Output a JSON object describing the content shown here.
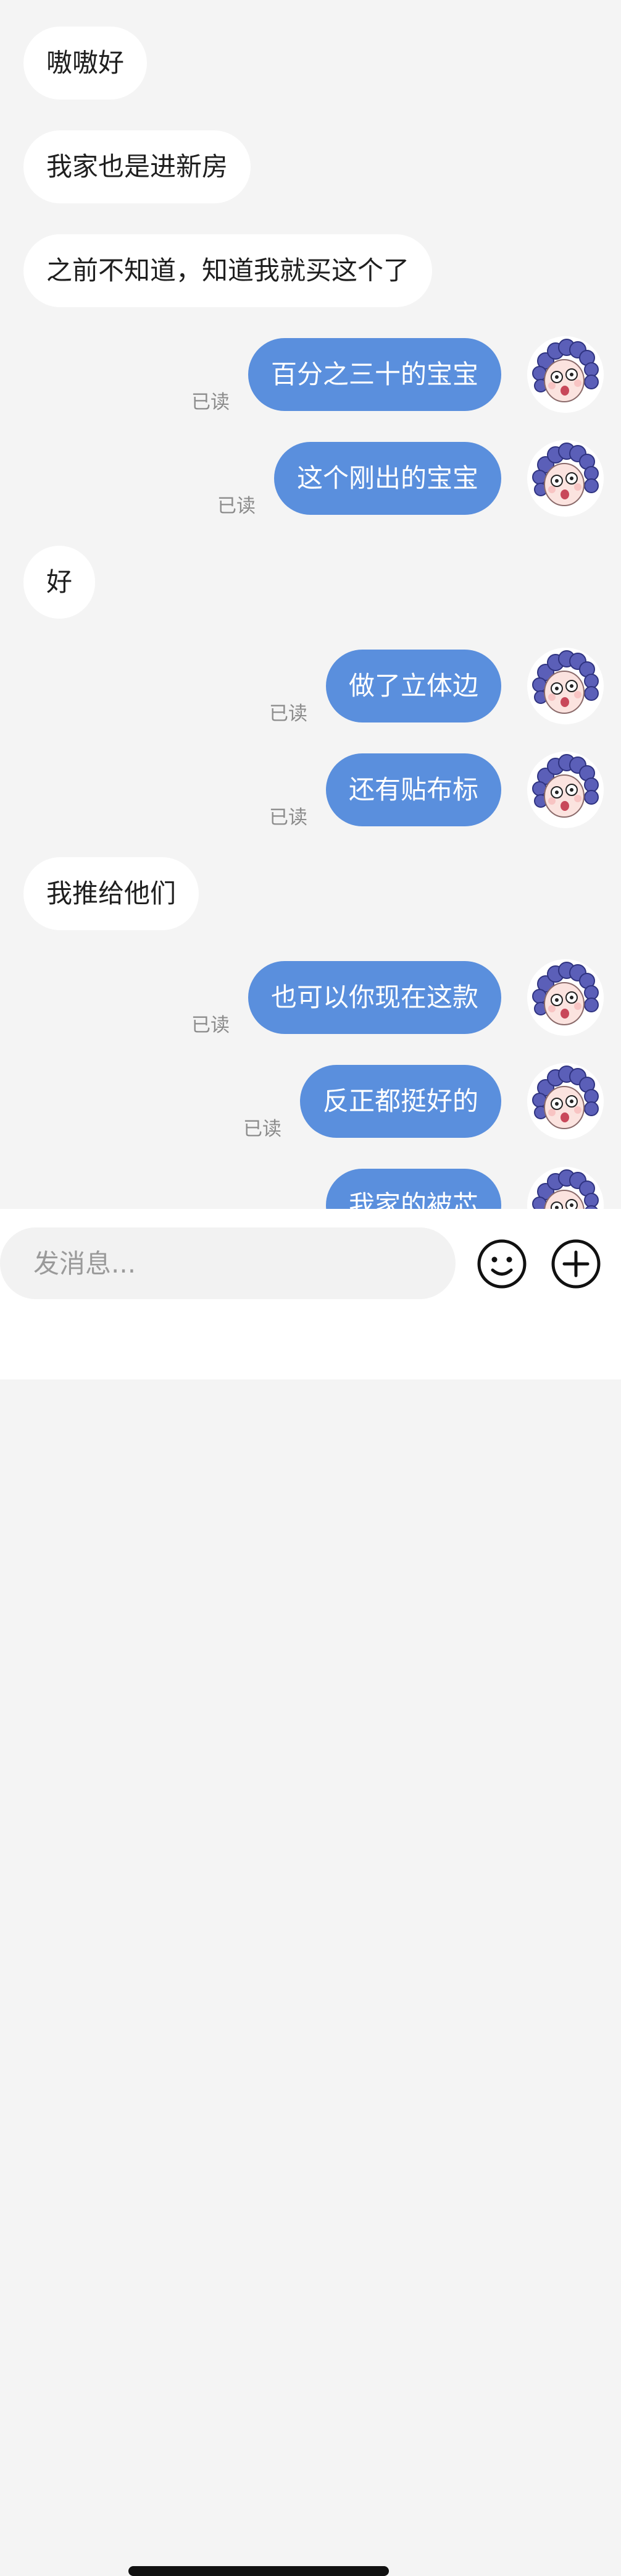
{
  "messages": [
    {
      "side": "in",
      "text": "嗷嗷好"
    },
    {
      "side": "in",
      "text": "我家也是进新房"
    },
    {
      "side": "in",
      "text": "之前不知道，知道我就买这个了"
    },
    {
      "side": "out",
      "text": "百分之三十的宝宝",
      "status": "已读"
    },
    {
      "side": "out",
      "text": "这个刚出的宝宝",
      "status": "已读"
    },
    {
      "side": "in",
      "text": "好"
    },
    {
      "side": "out",
      "text": "做了立体边",
      "status": "已读"
    },
    {
      "side": "out",
      "text": "还有贴布标",
      "status": "已读"
    },
    {
      "side": "in",
      "text": "我推给他们"
    },
    {
      "side": "out",
      "text": "也可以你现在这款",
      "status": "已读"
    },
    {
      "side": "out",
      "text": "反正都挺好的",
      "status": "已读"
    },
    {
      "side": "out",
      "text": "我家的被芯",
      "status": ""
    }
  ],
  "input": {
    "placeholder": "发消息..."
  },
  "icons": {
    "emoji": "smiley-icon",
    "add": "plus-circle-icon",
    "avatar": "cartoon-avatar"
  },
  "colors": {
    "outgoing_bubble": "#5a8fdd",
    "incoming_bubble": "#ffffff",
    "background": "#f4f4f4"
  }
}
